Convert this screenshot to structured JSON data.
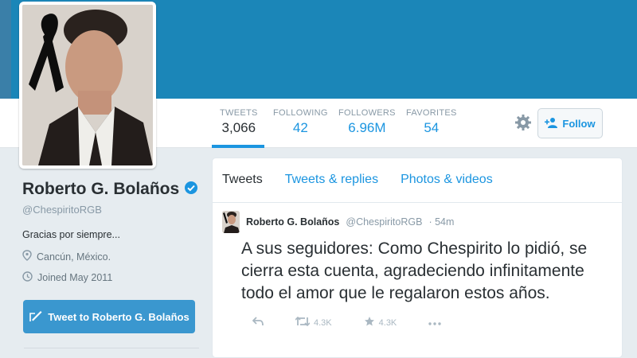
{
  "nav": {
    "stats": [
      {
        "label": "TWEETS",
        "value": "3,066"
      },
      {
        "label": "FOLLOWING",
        "value": "42"
      },
      {
        "label": "FOLLOWERS",
        "value": "6.96M"
      },
      {
        "label": "FAVORITES",
        "value": "54"
      }
    ],
    "follow_label": "Follow",
    "settings_icon": "gear-icon"
  },
  "profile": {
    "name": "Roberto G. Bolaños",
    "handle": "@ChespiritoRGB",
    "bio": "Gracias por siempre...",
    "location": "Cancún, México.",
    "joined": "Joined May 2011",
    "tweet_to_label": "Tweet to Roberto G. Bolaños",
    "verified": true
  },
  "timeline": {
    "tabs": [
      "Tweets",
      "Tweets & replies",
      "Photos & videos"
    ],
    "tweet": {
      "author": "Roberto G. Bolaños",
      "handle": "@ChespiritoRGB",
      "time": "· 54m",
      "text": "A sus seguidores: Como Chespirito lo pidió, se cierra esta cuenta, agradeciendo infinitamente todo el amor que le regalaron estos años.",
      "retweets": "4.3K",
      "favorites": "4.3K"
    }
  },
  "colors": {
    "banner": "#1b86b8",
    "accent": "#1b95e0",
    "tweet_button": "#3a97cf"
  }
}
